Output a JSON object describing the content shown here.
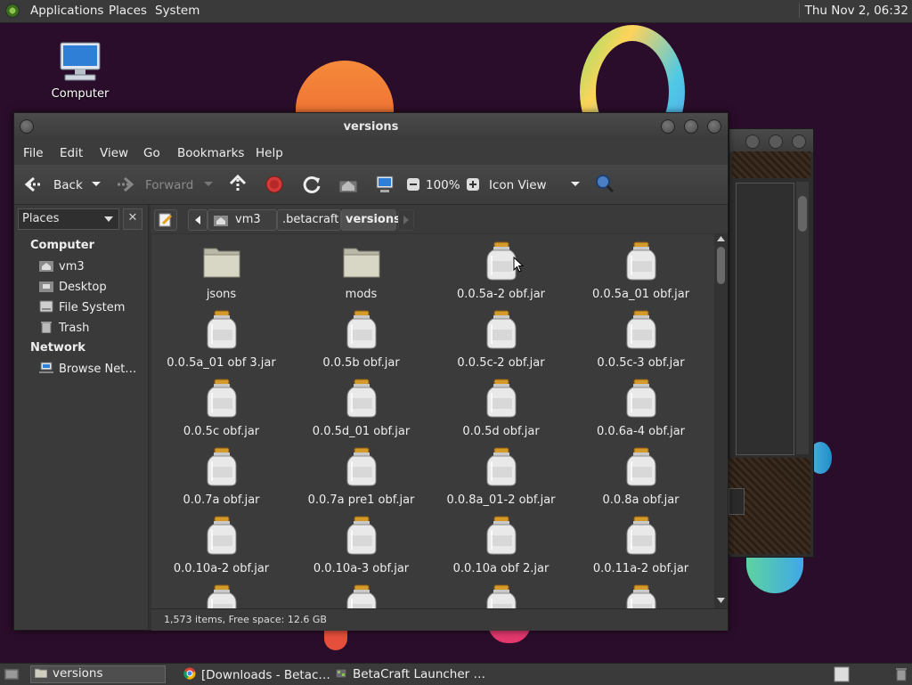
{
  "top_panel": {
    "menus": [
      "Applications",
      "Places",
      "System"
    ],
    "clock": "Thu Nov 2, 06:32"
  },
  "desktop": {
    "icons": [
      {
        "label": "Computer",
        "icon": "computer-icon"
      }
    ]
  },
  "window": {
    "title": "versions",
    "menubar": [
      "File",
      "Edit",
      "View",
      "Go",
      "Bookmarks",
      "Help"
    ],
    "toolbar": {
      "back_label": "Back",
      "forward_label": "Forward",
      "zoom": "100%",
      "view_mode": "Icon View"
    },
    "sidebar": {
      "selector": "Places",
      "sections": [
        {
          "heading": "Computer",
          "items": [
            {
              "label": "vm3",
              "icon": "home-folder-icon"
            },
            {
              "label": "Desktop",
              "icon": "desktop-folder-icon"
            },
            {
              "label": "File System",
              "icon": "drive-icon"
            },
            {
              "label": "Trash",
              "icon": "trash-icon"
            }
          ]
        },
        {
          "heading": "Network",
          "items": [
            {
              "label": "Browse Net…",
              "icon": "network-icon"
            }
          ]
        }
      ]
    },
    "breadcrumbs": [
      "vm3",
      ".betacraft",
      "versions"
    ],
    "files": [
      {
        "name": "jsons",
        "type": "folder"
      },
      {
        "name": "mods",
        "type": "folder"
      },
      {
        "name": "0.0.5a-2 obf.jar",
        "type": "jar"
      },
      {
        "name": "0.0.5a_01 obf.jar",
        "type": "jar"
      },
      {
        "name": "0.0.5a_01 obf 3.jar",
        "type": "jar"
      },
      {
        "name": "0.0.5b obf.jar",
        "type": "jar"
      },
      {
        "name": "0.0.5c-2 obf.jar",
        "type": "jar"
      },
      {
        "name": "0.0.5c-3 obf.jar",
        "type": "jar"
      },
      {
        "name": "0.0.5c obf.jar",
        "type": "jar"
      },
      {
        "name": "0.0.5d_01 obf.jar",
        "type": "jar"
      },
      {
        "name": "0.0.5d obf.jar",
        "type": "jar"
      },
      {
        "name": "0.0.6a-4 obf.jar",
        "type": "jar"
      },
      {
        "name": "0.0.7a obf.jar",
        "type": "jar"
      },
      {
        "name": "0.0.7a pre1 obf.jar",
        "type": "jar"
      },
      {
        "name": "0.0.8a_01-2 obf.jar",
        "type": "jar"
      },
      {
        "name": "0.0.8a obf.jar",
        "type": "jar"
      },
      {
        "name": "0.0.10a-2 obf.jar",
        "type": "jar"
      },
      {
        "name": "0.0.10a-3 obf.jar",
        "type": "jar"
      },
      {
        "name": "0.0.10a obf 2.jar",
        "type": "jar"
      },
      {
        "name": "0.0.11a-2 obf.jar",
        "type": "jar"
      },
      {
        "name": "",
        "type": "jar"
      },
      {
        "name": "",
        "type": "jar"
      },
      {
        "name": "",
        "type": "jar"
      },
      {
        "name": "",
        "type": "jar"
      }
    ],
    "status": "1,573 items, Free space: 12.6 GB"
  },
  "taskbar": {
    "items": [
      {
        "label": "versions",
        "icon": "folder-icon"
      },
      {
        "label": "[Downloads - Betac…",
        "icon": "chrome-icon"
      },
      {
        "label": "BetaCraft Launcher …",
        "icon": "java-icon"
      }
    ]
  },
  "colors": {
    "desktop_bg": "#2a0d2a",
    "panel_bg": "#3a3a3a",
    "stop_red": "#d23a3a"
  }
}
